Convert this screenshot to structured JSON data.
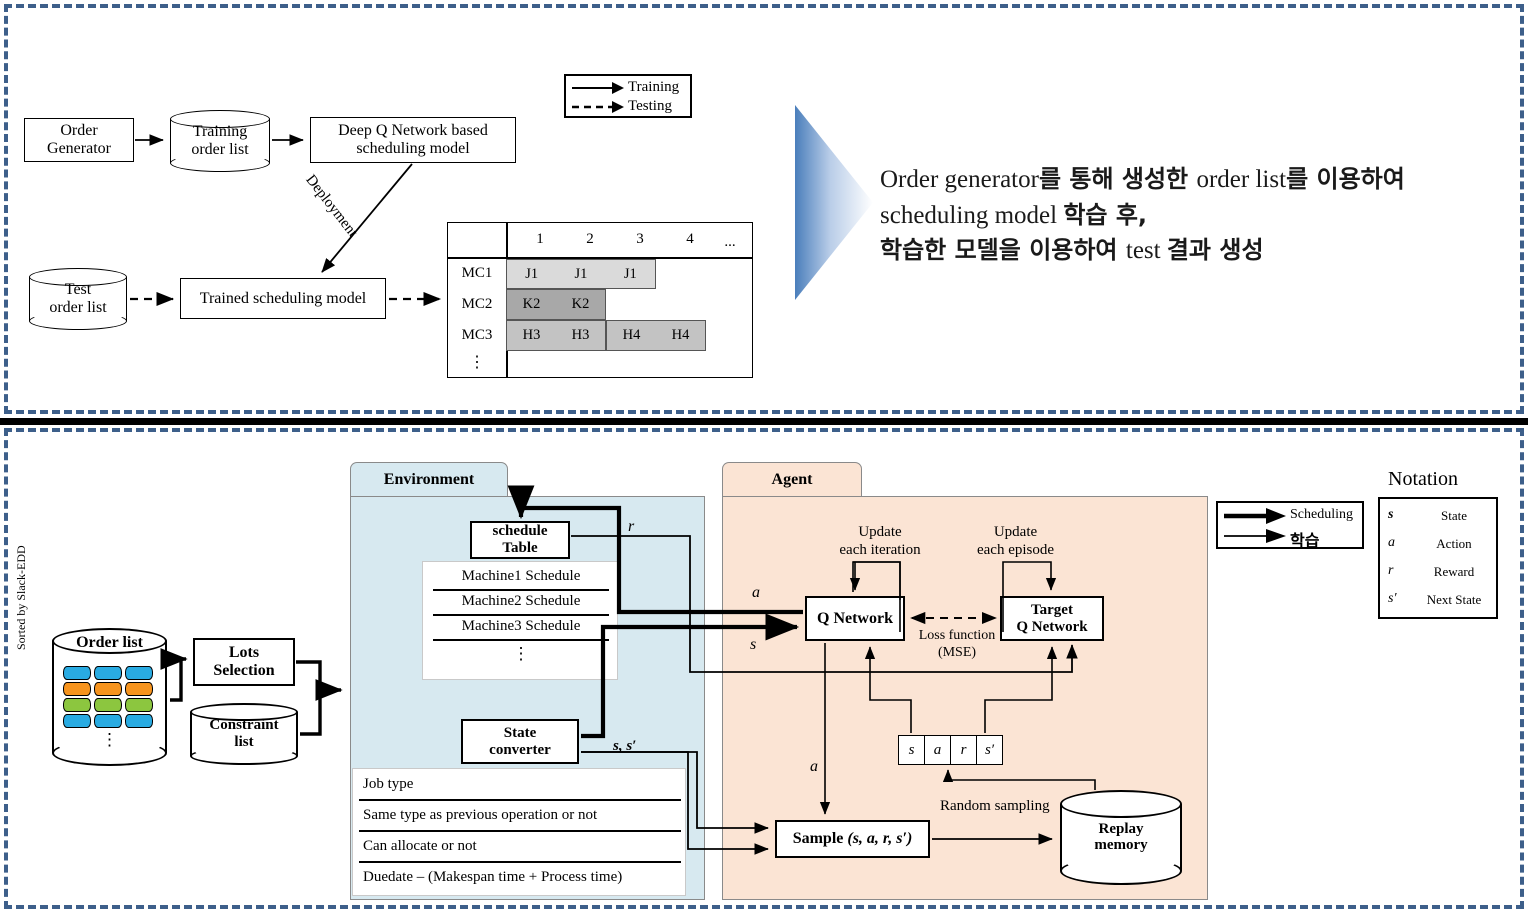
{
  "top_panel": {
    "legend": {
      "title": "flow-legend",
      "items": [
        {
          "label": "Training",
          "style": "solid"
        },
        {
          "label": "Testing",
          "style": "dashed"
        }
      ]
    },
    "nodes": {
      "order_generator": "Order\nGenerator",
      "order_generator_l1": "Order",
      "order_generator_l2": "Generator",
      "training_order_list_l1": "Training",
      "training_order_list_l2": "order list",
      "dqn_model_l1": "Deep Q Network based",
      "dqn_model_l2": "scheduling model",
      "deployment_label": "Deployment",
      "test_order_list_l1": "Test",
      "test_order_list_l2": "order list",
      "trained_model": "Trained scheduling model"
    },
    "gantt": {
      "column_headers": [
        "1",
        "2",
        "3",
        "4",
        "..."
      ],
      "row_headers": [
        "MC1",
        "MC2",
        "MC3",
        "⋮"
      ],
      "bars": [
        {
          "row": "MC1",
          "label": "J1",
          "cells": [
            "J1",
            "J1",
            "J1"
          ],
          "color": "#dadada"
        },
        {
          "row": "MC2",
          "label": "K2",
          "cells": [
            "K2",
            "K2"
          ],
          "color": "#a8a8a8"
        },
        {
          "row": "MC3",
          "label": "H3",
          "cells": [
            "H3",
            "H3"
          ],
          "color": "#c3c3c3"
        },
        {
          "row": "MC3",
          "label": "H4",
          "cells": [
            "H4",
            "H4"
          ],
          "color": "#c3c3c3"
        }
      ]
    },
    "callout": {
      "line1": "Order generator를  통해 생성한 order list를 이용하여",
      "line2": "scheduling  model 학습 후,",
      "line3": "학습한 모델을 이용하여 test 결과 생성",
      "line1_a": "Order generator",
      "line1_b": "를  통해 생성한 ",
      "line1_c": "order list",
      "line1_d": "를 이용하여",
      "line2_a": "scheduling  model ",
      "line2_b": "학습 후,",
      "line3_a": "학습한 모델을 이용하여 ",
      "line3_b": "test ",
      "line3_c": "결과 생성"
    }
  },
  "bottom_panel": {
    "order_list": {
      "title": "Order list",
      "sorted_by": "Sorted by Slack-EDD",
      "ellipsis": "⋮",
      "lot_colors": [
        "#29abe2",
        "#f7941e",
        "#8cc63f",
        "#29abe2"
      ]
    },
    "lots_selection": {
      "line1": "Lots",
      "line2": "Selection"
    },
    "constraint_list": {
      "line1": "Constraint",
      "line2": "list"
    },
    "environment": {
      "title": "Environment",
      "schedule_table": {
        "line1": "schedule",
        "line2": "Table"
      },
      "machine_schedules": [
        "Machine1  Schedule",
        "Machine2  Schedule",
        "Machine3  Schedule",
        "⋮"
      ],
      "state_converter": {
        "line1": "State",
        "line2": "converter"
      },
      "state_features": [
        "Job type",
        "Same type as previous operation or not",
        "Can allocate or not",
        "Duedate – (Makespan time + Process time)"
      ],
      "edge_labels": {
        "reward": "r",
        "state_pair": "s, s′"
      }
    },
    "agent": {
      "title": "Agent",
      "q_network": "Q Network",
      "target_q_network": {
        "line1": "Target",
        "line2": "Q Network"
      },
      "update_q": {
        "line1": "Update",
        "line2": "each iteration"
      },
      "update_target": {
        "line1": "Update",
        "line2": "each episode"
      },
      "loss": {
        "line1": "Loss function",
        "line2": "(MSE)"
      },
      "sample": {
        "prefix": "Sample ",
        "tuple": "(s, a, r, s′)"
      },
      "replay_memory": {
        "line1": "Replay",
        "line2": "memory"
      },
      "random_sampling": "Random sampling",
      "tuple_cells": [
        "s",
        "a",
        "r",
        "s′"
      ],
      "edge_labels": {
        "action_in": "a",
        "state_in": "s",
        "action_down": "a"
      }
    },
    "legend": {
      "items": [
        {
          "label": "Scheduling",
          "weight": "thick"
        },
        {
          "label": "학습",
          "weight": "thin"
        }
      ]
    },
    "notation": {
      "title": "Notation",
      "rows": [
        {
          "symbol": "s",
          "meaning": "State"
        },
        {
          "symbol": "a",
          "meaning": "Action"
        },
        {
          "symbol": "r",
          "meaning": "Reward"
        },
        {
          "symbol": "s′",
          "meaning": "Next State"
        }
      ]
    }
  },
  "colors": {
    "panel_border": "#3d5f8a",
    "environment_fill": "#d7e9f0",
    "agent_fill": "#fbe4d4",
    "lot_blue": "#29abe2",
    "lot_orange": "#f7941e",
    "lot_green": "#8cc63f",
    "gantt_light": "#dadada",
    "gantt_dark": "#a8a8a8",
    "gantt_mid": "#c3c3c3"
  }
}
